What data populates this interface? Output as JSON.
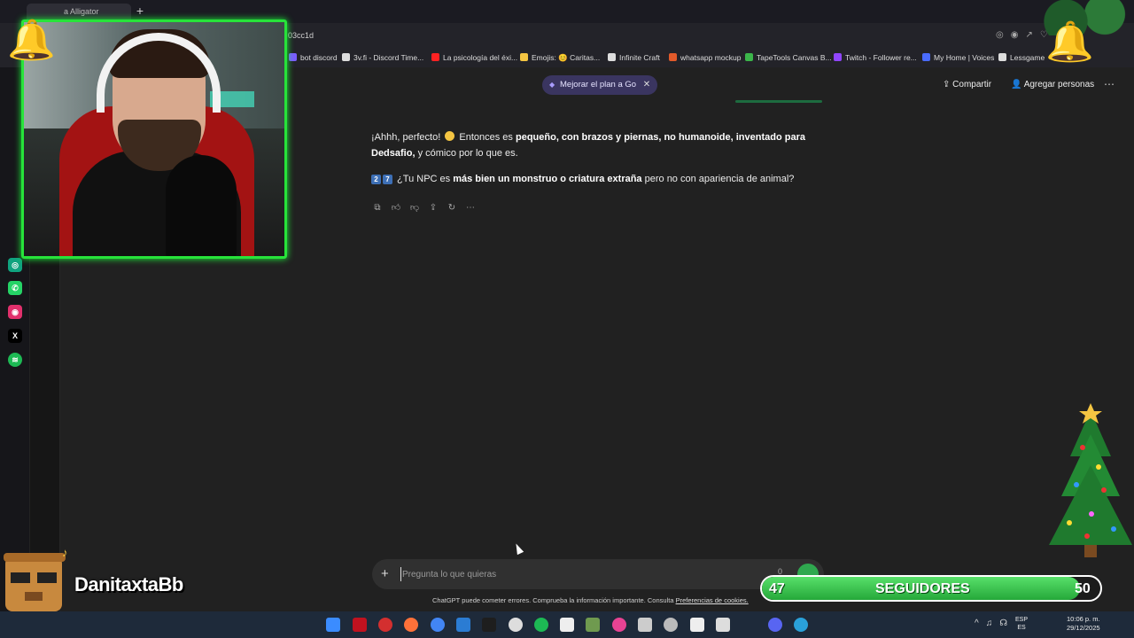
{
  "browser": {
    "tab_title": "a Alligator",
    "url_fragment": "03cc1d",
    "bookmarks": [
      {
        "label": "bot discord",
        "color": "#7a5cff"
      },
      {
        "label": "3v.fi - Discord Time...",
        "color": "#dddddd"
      },
      {
        "label": "La psicología del éxi...",
        "color": "#ff2222"
      },
      {
        "label": "Emojis: 😊 Caritas...",
        "color": "#f4c542"
      },
      {
        "label": "Infinite Craft",
        "color": "#dddddd"
      },
      {
        "label": "whatsapp mockup",
        "color": "#e25a2a"
      },
      {
        "label": "TapeTools Canvas B...",
        "color": "#3bb54a"
      },
      {
        "label": "Twitch - Follower re...",
        "color": "#9146ff"
      },
      {
        "label": "My Home | Voices",
        "color": "#4a6cff"
      },
      {
        "label": "Lessgame",
        "color": "#dddddd"
      }
    ]
  },
  "sidebar": {
    "icons": [
      {
        "name": "chatgpt-icon",
        "color": "#10a37f"
      },
      {
        "name": "whatsapp-icon",
        "color": "#25d366"
      },
      {
        "name": "instagram-icon",
        "color": "#e1306c"
      },
      {
        "name": "x-icon",
        "color": "#000000"
      },
      {
        "name": "spotify-icon",
        "color": "#1db954"
      }
    ]
  },
  "header": {
    "upgrade_label": "Mejorar el plan a Go",
    "share_label": "Compartir",
    "add_people_label": "Agregar personas"
  },
  "conversation": {
    "msg1_start": "¡Ahhh, perfecto! ",
    "msg1_mid": " Entonces es ",
    "msg1_bold": "pequeño, con brazos y piernas, no humanoide, inventado para Dedsafio,",
    "msg1_end": " y cómico por lo que es.",
    "msg2_num1": "2",
    "msg2_num2": "7",
    "msg2_start": " ¿Tu NPC es ",
    "msg2_bold": "más bien un monstruo o criatura extraña",
    "msg2_end": " pero no con apariencia de animal?"
  },
  "composer": {
    "placeholder": "Pregunta lo que quieras",
    "mic_label": "0",
    "disclaimer": "ChatGPT puede cometer errores. Comprueba la información importante. Consulta ",
    "disclaimer_link": "Preferencias de cookies."
  },
  "stream_overlay": {
    "streamer_name": "DanitaxtaBb",
    "followers_current": "47",
    "followers_label": "SEGUIDORES",
    "followers_goal": "50",
    "followers_progress": 0.94
  },
  "taskbar": {
    "lang_line1": "ESP",
    "lang_line2": "ES",
    "time": "10:06 p. m.",
    "date": "29/12/2025"
  }
}
